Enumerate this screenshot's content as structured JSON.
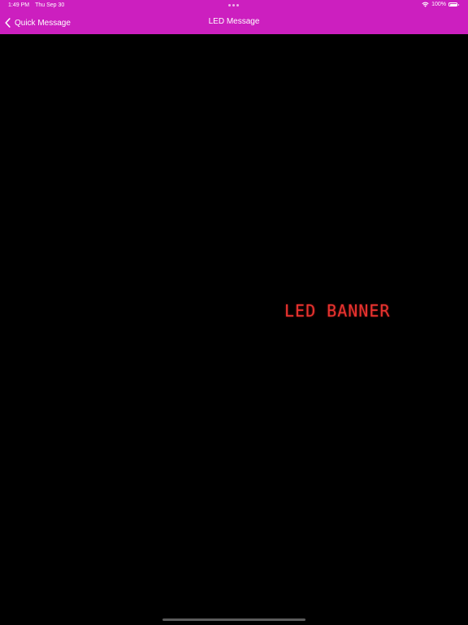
{
  "status_bar": {
    "time": "1:49 PM",
    "date": "Thu Sep 30",
    "battery_percent": "100%",
    "battery_level": 1.0,
    "wifi_icon": "wifi-icon",
    "battery_icon": "battery-icon",
    "multitasking_icon": "multitasking-dots-icon"
  },
  "nav": {
    "back_label": "Quick Message",
    "back_icon": "chevron-left-icon",
    "title": "LED Message"
  },
  "led": {
    "text": "LED BANNER",
    "color": "#e8332f",
    "background": "#000000"
  },
  "colors": {
    "accent": "#cc1fbf"
  }
}
